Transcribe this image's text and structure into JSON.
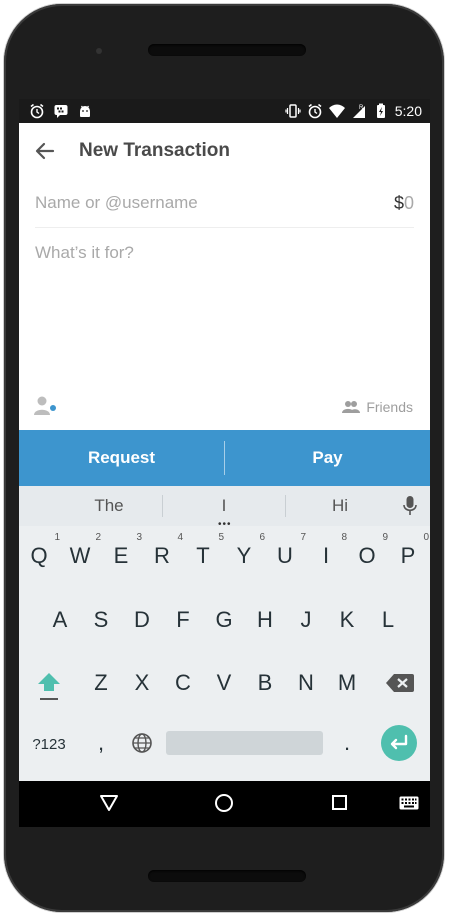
{
  "status_bar": {
    "time": "5:20",
    "left_icons": [
      "alarm-icon",
      "bbm-icon",
      "android-icon"
    ],
    "right_icons": [
      "vibrate-icon",
      "alarm-icon",
      "wifi-icon",
      "signal-icon",
      "battery-icon"
    ]
  },
  "appbar": {
    "title": "New Transaction",
    "back_icon": "arrow-left-icon"
  },
  "form": {
    "to_placeholder": "Name or @username",
    "currency_symbol": "$",
    "amount": "0",
    "note_placeholder": "What’s it for?",
    "privacy_label": "Friends"
  },
  "actions": {
    "request_label": "Request",
    "pay_label": "Pay",
    "accent_color": "#3d95ce"
  },
  "keyboard": {
    "suggestions": [
      "The",
      "I",
      "Hi"
    ],
    "row1": [
      "Q",
      "W",
      "E",
      "R",
      "T",
      "Y",
      "U",
      "I",
      "O",
      "P"
    ],
    "row1_numbers": [
      "1",
      "2",
      "3",
      "4",
      "5",
      "6",
      "7",
      "8",
      "9",
      "0"
    ],
    "row2": [
      "A",
      "S",
      "D",
      "F",
      "G",
      "H",
      "J",
      "K",
      "L"
    ],
    "row3": [
      "Z",
      "X",
      "C",
      "V",
      "B",
      "N",
      "M"
    ],
    "symbols_label": "?123",
    "comma": ",",
    "period": ".",
    "enter_color": "#4fbfae"
  }
}
